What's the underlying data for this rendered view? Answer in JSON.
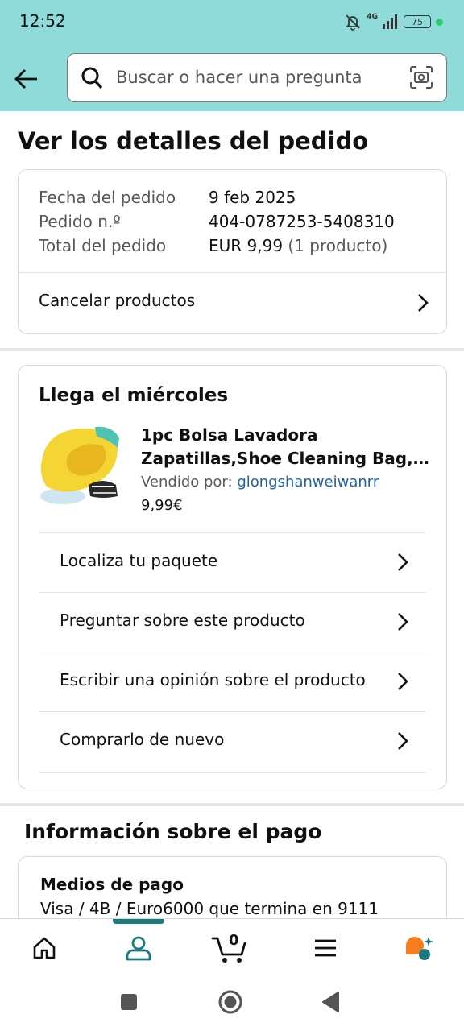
{
  "status_bar": {
    "time": "12:52",
    "network": "4G",
    "battery": "75"
  },
  "header": {
    "search_placeholder": "Buscar o hacer una pregunta"
  },
  "page_title": "Ver los detalles del pedido",
  "order_summary": {
    "date_label": "Fecha del pedido",
    "date_value": "9 feb 2025",
    "number_label": "Pedido n.º",
    "number_value": "404-0787253-5408310",
    "total_label": "Total del pedido",
    "total_value": "EUR 9,99",
    "total_count": "(1 producto)",
    "cancel_label": "Cancelar productos"
  },
  "delivery": {
    "title": "Llega el miércoles",
    "product_title_line1": "1pc Bolsa Lavadora",
    "product_title_line2": "Zapatillas,Shoe Cleaning Bag,La...",
    "seller_prefix": "Vendido por:",
    "seller_name": "glongshanweiwanrr",
    "price": "9,99€",
    "actions": [
      "Localiza tu paquete",
      "Preguntar sobre este producto",
      "Escribir una opinión sobre el producto",
      "Comprarlo de nuevo"
    ]
  },
  "payment": {
    "section_title": "Información sobre el pago",
    "method_label": "Medios de pago",
    "method_value": "Visa / 4B / Euro6000  que termina en 9111"
  },
  "bottom_nav": {
    "cart_count": "0",
    "active_tab": "account"
  },
  "colors": {
    "header_bg": "#8fdbd9",
    "link": "#2162a1",
    "active_tab": "#1a7a80",
    "rufus_orange": "#f57c1f"
  }
}
